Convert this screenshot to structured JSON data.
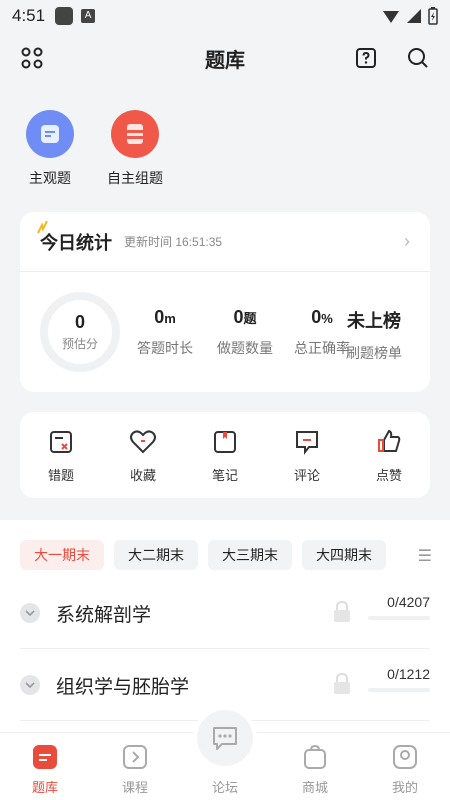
{
  "status_bar": {
    "time": "4:51",
    "a_icon": "A"
  },
  "header": {
    "title": "题库"
  },
  "quick_actions": [
    {
      "label": "主观题",
      "icon": "document-icon",
      "color": "#6f8df5"
    },
    {
      "label": "自主组题",
      "icon": "stack-icon",
      "color": "#f0584a"
    }
  ],
  "stats": {
    "title": "今日统计",
    "updated_label": "更新时间 16:51:35",
    "score": {
      "value": "0",
      "label": "预估分"
    },
    "items": [
      {
        "value": "0",
        "unit": "m",
        "label": "答题时长"
      },
      {
        "value": "0",
        "unit": "题",
        "label": "做题数量"
      },
      {
        "value": "0",
        "unit": "%",
        "label": "总正确率"
      },
      {
        "value": "未上榜",
        "unit": "",
        "label": "刷题榜单"
      }
    ]
  },
  "tools": [
    {
      "label": "错题",
      "icon": "wrong-icon"
    },
    {
      "label": "收藏",
      "icon": "heart-icon"
    },
    {
      "label": "笔记",
      "icon": "note-icon"
    },
    {
      "label": "评论",
      "icon": "comment-icon"
    },
    {
      "label": "点赞",
      "icon": "thumbs-up-icon"
    }
  ],
  "term_tabs": [
    "大一期末",
    "大二期末",
    "大三期末",
    "大四期末"
  ],
  "subjects": [
    {
      "name": "系统解剖学",
      "progress": "0/4207"
    },
    {
      "name": "组织学与胚胎学",
      "progress": "0/1212"
    }
  ],
  "tab_bar": [
    {
      "label": "题库",
      "icon": "question-bank-icon"
    },
    {
      "label": "课程",
      "icon": "play-icon"
    },
    {
      "label": "论坛",
      "icon": "forum-icon"
    },
    {
      "label": "商城",
      "icon": "shop-icon"
    },
    {
      "label": "我的",
      "icon": "profile-icon"
    }
  ],
  "accent_color": "#e94b3c"
}
